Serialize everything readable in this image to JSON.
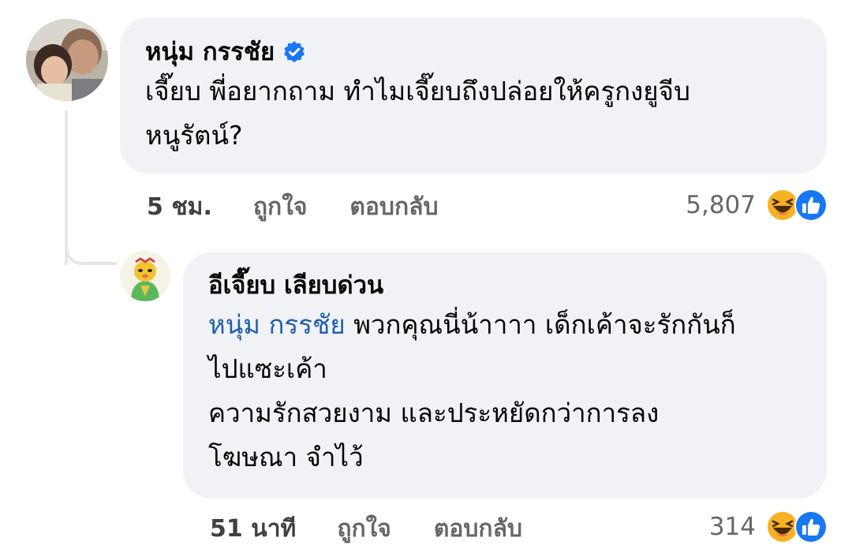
{
  "comment": {
    "author": "หนุ่ม กรรชัย",
    "verified_icon": "verified-badge-icon",
    "lines": [
      "เจี๊ยบ พี่อยากถาม ทำไมเจี๊ยบถึงปล่อยให้ครูกงยูจีบ",
      "หนูรัตน์?"
    ],
    "time": "5 ชม.",
    "like_label": "ถูกใจ",
    "reply_label": "ตอบกลับ",
    "reaction_count": "5,807",
    "reaction_icons": [
      "haha-icon",
      "like-icon"
    ]
  },
  "reply": {
    "author": "อีเจี๊ยบ เลียบด่วน",
    "mention": "หนุ่ม กรรชัย",
    "first_line_rest": "พวกคุณนี่น้าาาา เด็กเค้าจะรักกันก็",
    "lines": [
      "ไปแซะเค้า",
      "ความรักสวยงาม และประหยัดกว่าการลง",
      "โฆษณา จำไว้"
    ],
    "time": "51 นาที",
    "like_label": "ถูกใจ",
    "reply_label": "ตอบกลับ",
    "reaction_count": "314",
    "reaction_icons": [
      "haha-icon",
      "like-icon"
    ]
  },
  "colors": {
    "bubble": "#f0f2f5",
    "mention": "#1f5fae",
    "meta": "#65676b",
    "verified": "#1877f2",
    "like": "#1877f2",
    "haha": "#f7b125"
  }
}
